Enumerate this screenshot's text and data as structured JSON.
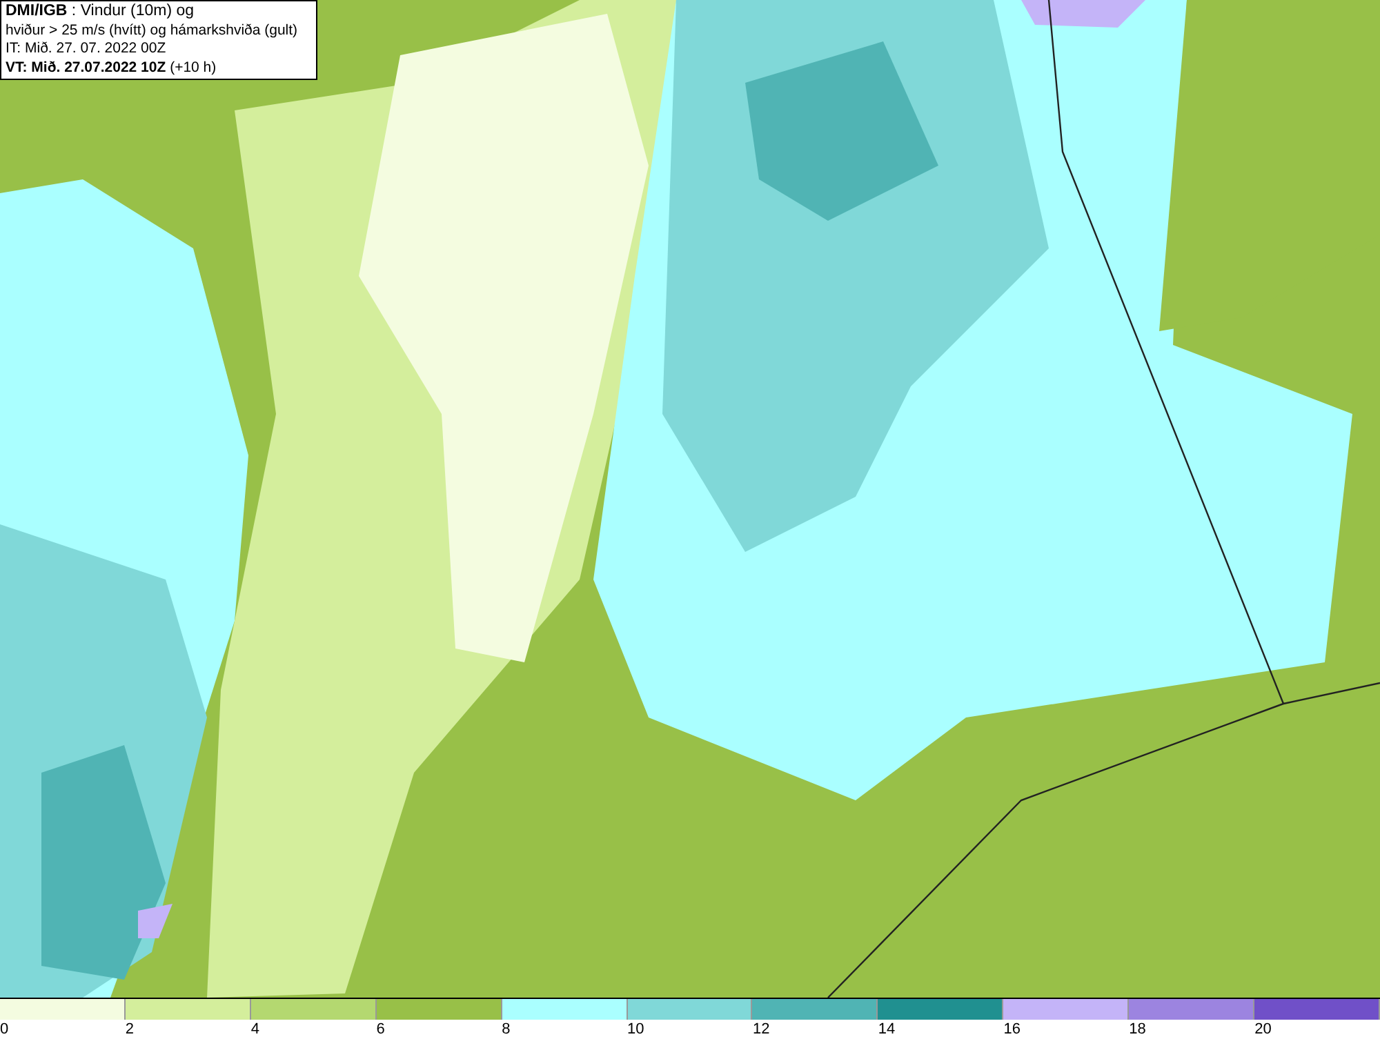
{
  "title_box": {
    "lines": [
      "**DMI/IGB** : Vindur (10m) og",
      "hviður > 25 m/s (hvítt) og hámarkshviða (gult)",
      "IT: Mið. 27. 07. 2022 00Z",
      "**VT: Mið. 27.07.2022 10Z** (+10 h)"
    ]
  },
  "legend": {
    "bins": [
      {
        "color": "#f4fce0"
      },
      {
        "color": "#d4ee9c"
      },
      {
        "color": "#b4d870"
      },
      {
        "color": "#98c048"
      },
      {
        "color": "#aaffff"
      },
      {
        "color": "#80d8d8"
      },
      {
        "color": "#50b4b4"
      },
      {
        "color": "#209090"
      },
      {
        "color": "#c4b4f8"
      },
      {
        "color": "#9c84e0"
      },
      {
        "color": "#7050c8"
      }
    ],
    "labels": [
      "0",
      "2",
      "4",
      "6",
      "8",
      "10",
      "12",
      "14",
      "16",
      "18",
      "20"
    ]
  }
}
